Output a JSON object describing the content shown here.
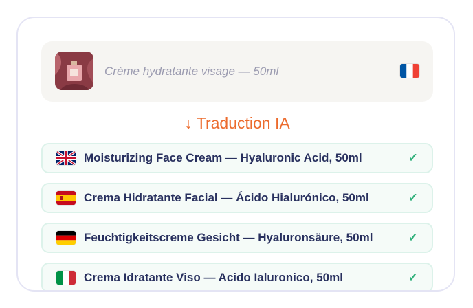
{
  "source": {
    "product_name": "Crème hydratante visage — 50ml",
    "flag_icon": "france-flag-icon"
  },
  "translation_label": "↓ Traduction IA",
  "translations": [
    {
      "flag_icon": "uk-flag-icon",
      "text": "Moisturizing Face Cream — Hyaluronic Acid, 50ml",
      "status": "✓"
    },
    {
      "flag_icon": "spain-flag-icon",
      "text": "Crema Hidratante Facial — Ácido Hialurónico, 50ml",
      "status": "✓"
    },
    {
      "flag_icon": "germany-flag-icon",
      "text": "Feuchtigkeitscreme Gesicht — Hyaluronsäure, 50ml",
      "status": "✓"
    },
    {
      "flag_icon": "italy-flag-icon",
      "text": "Crema Idratante Viso — Acido Ialuronico, 50ml",
      "status": "✓"
    }
  ],
  "colors": {
    "accent": "#ec6b2d",
    "check": "#2fb07a",
    "text": "#28305e"
  }
}
